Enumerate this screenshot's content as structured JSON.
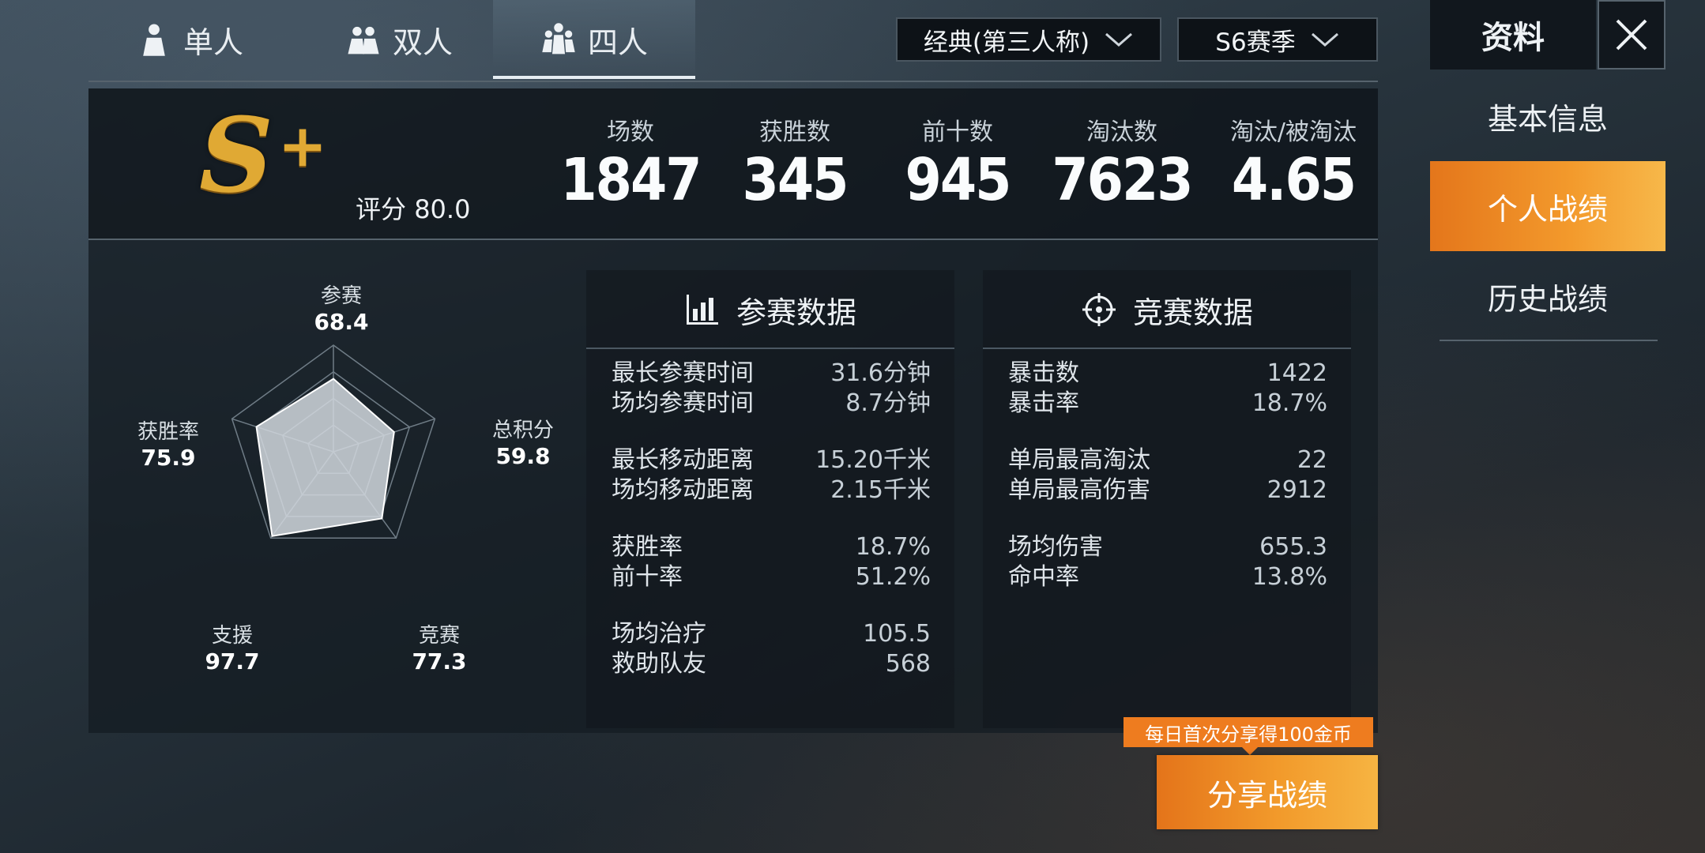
{
  "tabs": [
    {
      "label": "单人",
      "icon": "person-icon"
    },
    {
      "label": "双人",
      "icon": "duo-icon"
    },
    {
      "label": "四人",
      "icon": "squad-icon"
    }
  ],
  "active_tab": "四人",
  "dropdowns": {
    "mode": "经典(第三人称)",
    "season": "S6赛季"
  },
  "summary": {
    "rank": "S",
    "rank_plus": "+",
    "score_label": "评分",
    "score_value": "80.0",
    "stats": [
      {
        "label": "场数",
        "value": "1847"
      },
      {
        "label": "获胜数",
        "value": "345"
      },
      {
        "label": "前十数",
        "value": "945"
      },
      {
        "label": "淘汰数",
        "value": "7623"
      },
      {
        "label": "淘汰/被淘汰",
        "value": "4.65"
      }
    ]
  },
  "radar": {
    "axes": [
      {
        "label": "参赛",
        "value": "68.4"
      },
      {
        "label": "总积分",
        "value": "59.8"
      },
      {
        "label": "竞赛",
        "value": "77.3"
      },
      {
        "label": "支援",
        "value": "97.7"
      },
      {
        "label": "获胜率",
        "value": "75.9"
      }
    ]
  },
  "participation": {
    "title": "参赛数据",
    "rows": [
      {
        "label": "最长参赛时间",
        "value": "31.6分钟"
      },
      {
        "label": "场均参赛时间",
        "value": "8.7分钟"
      },
      {
        "label": "最长移动距离",
        "value": "15.20千米"
      },
      {
        "label": "场均移动距离",
        "value": "2.15千米"
      },
      {
        "label": "获胜率",
        "value": "18.7%"
      },
      {
        "label": "前十率",
        "value": "51.2%"
      },
      {
        "label": "场均治疗",
        "value": "105.5"
      },
      {
        "label": "救助队友",
        "value": "568"
      }
    ]
  },
  "competition": {
    "title": "竞赛数据",
    "rows": [
      {
        "label": "暴击数",
        "value": "1422"
      },
      {
        "label": "暴击率",
        "value": "18.7%"
      },
      {
        "label": "单局最高淘汰",
        "value": "22"
      },
      {
        "label": "单局最高伤害",
        "value": "2912"
      },
      {
        "label": "场均伤害",
        "value": "655.3"
      },
      {
        "label": "命中率",
        "value": "13.8%"
      }
    ]
  },
  "right_menu": {
    "title": "资料",
    "items": [
      "基本信息",
      "个人战绩",
      "历史战绩"
    ],
    "active": "个人战绩"
  },
  "share": {
    "tip": "每日首次分享得100金币",
    "button": "分享战绩"
  },
  "colors": {
    "accent": "#f39a2c",
    "rank_gold": "#e0a934"
  }
}
